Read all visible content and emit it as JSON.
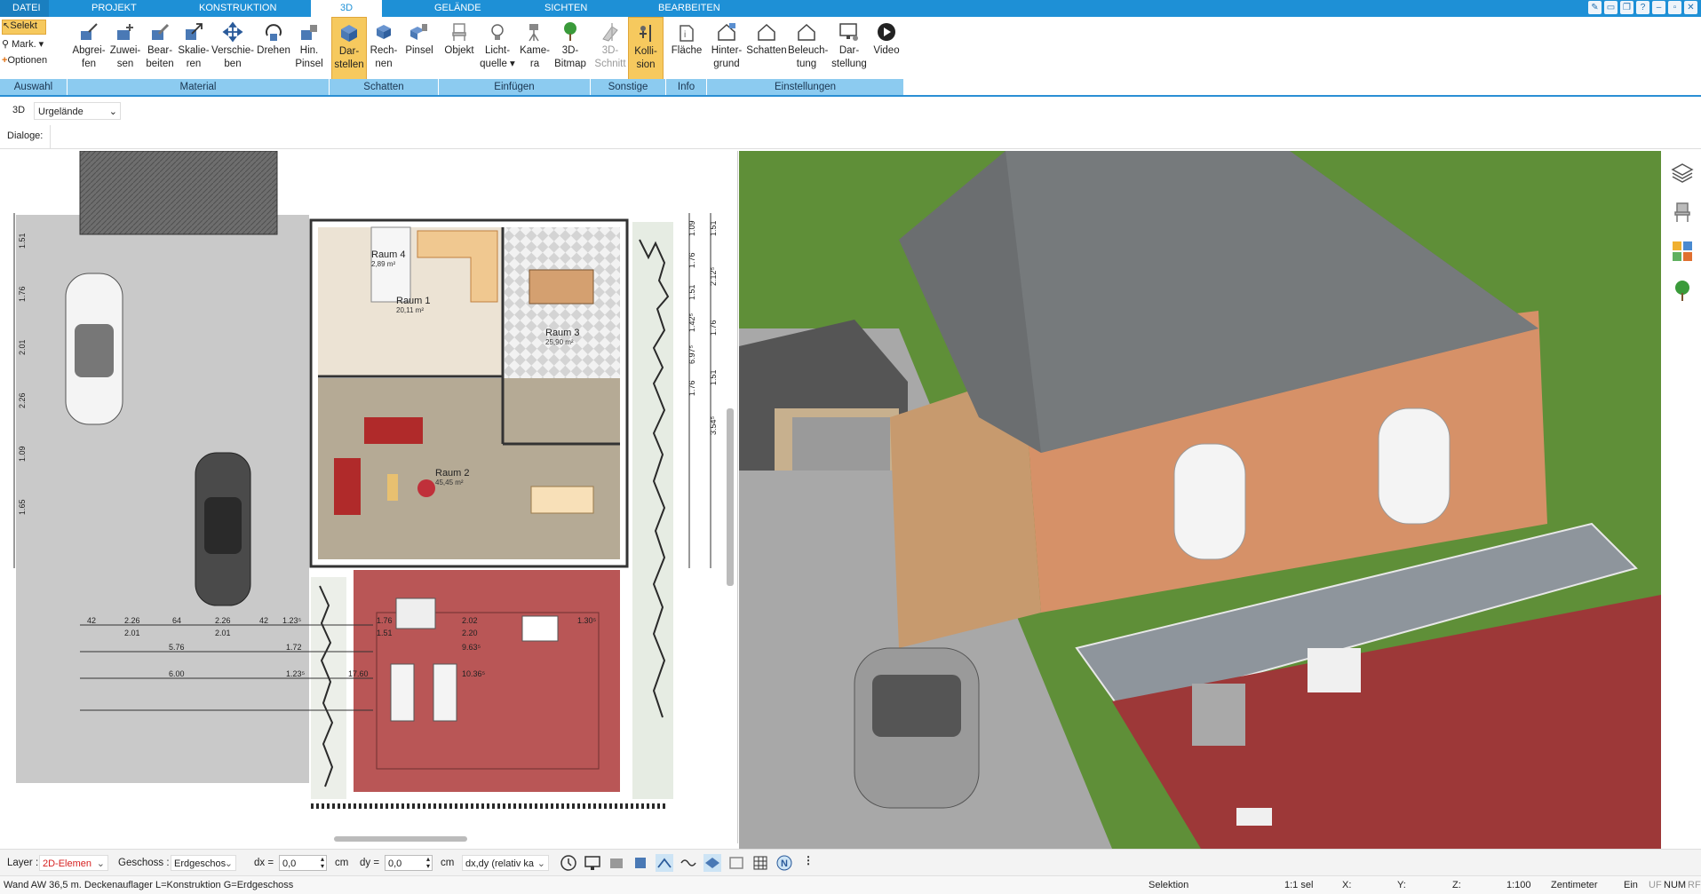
{
  "tabs": {
    "datei": "DATEI",
    "projekt": "PROJEKT",
    "konstruktion": "KONSTRUKTION",
    "d3": "3D",
    "gelaende": "GELÄNDE",
    "sichten": "SICHTEN",
    "bearbeiten": "BEARBEITEN"
  },
  "selection": {
    "selekt": "Selekt",
    "mark": "Mark.",
    "optionen": "Optionen"
  },
  "ribbon": {
    "abgreifen": [
      "Abgrei-",
      "fen"
    ],
    "zuweisen": [
      "Zuwei-",
      "sen"
    ],
    "bearbeiten": [
      "Bear-",
      "beiten"
    ],
    "skalieren": [
      "Skalie-",
      "ren"
    ],
    "verschieben": [
      "Verschie-",
      "ben"
    ],
    "drehen": [
      "Drehen",
      ""
    ],
    "hinpinsel": [
      "Hin.",
      "Pinsel"
    ],
    "darstellen": [
      "Dar-",
      "stellen"
    ],
    "rechnen": [
      "Rech-",
      "nen"
    ],
    "pinsel": [
      "Pinsel",
      ""
    ],
    "objekt": [
      "Objekt",
      ""
    ],
    "lichtquelle": [
      "Licht-",
      "quelle"
    ],
    "kamera": [
      "Kame-",
      "ra"
    ],
    "bitmap": [
      "3D-",
      "Bitmap"
    ],
    "schnitt": [
      "3D-",
      "Schnitt"
    ],
    "kollision": [
      "Kolli-",
      "sion"
    ],
    "flaeche": [
      "Fläche",
      ""
    ],
    "hintergrund": [
      "Hinter-",
      "grund"
    ],
    "schatten": [
      "Schatten",
      ""
    ],
    "beleuchtung": [
      "Beleuch-",
      "tung"
    ],
    "darstellung": [
      "Dar-",
      "stellung"
    ],
    "video": [
      "Video",
      ""
    ]
  },
  "groups": {
    "auswahl": "Auswahl",
    "material": "Material",
    "schatten": "Schatten",
    "einfuegen": "Einfügen",
    "sonstige": "Sonstige",
    "info": "Info",
    "einstellungen": "Einstellungen"
  },
  "viewbar": {
    "mode": "3D",
    "terrain": "Urgelände"
  },
  "dialogbar": {
    "label": "Dialoge:"
  },
  "plan": {
    "rooms": [
      {
        "name": "Raum 4",
        "area": "2,89 m²"
      },
      {
        "name": "Raum 1",
        "area": "20,11 m²"
      },
      {
        "name": "Raum 3",
        "area": "25,90 m²"
      },
      {
        "name": "Raum 2",
        "area": "45,45 m²"
      }
    ],
    "dims_top": [
      "42",
      "2.26",
      "64",
      "2.26",
      "42",
      "1.23⁵",
      "1.76",
      "2.02",
      "1.30⁵"
    ],
    "dims_top2": [
      "2.01",
      "2.01",
      "1.51",
      "2.20"
    ],
    "dims_mid": [
      "5.76",
      "1.72",
      "9.63⁵"
    ],
    "dims_low": [
      "6.00",
      "1.23⁵",
      "10.36⁵",
      "17.60"
    ],
    "dims_right": [
      "1.09",
      "1.76",
      "1.51",
      "1.42⁵",
      "6.97⁵",
      "1.76",
      "1.51",
      "2.12⁵",
      "1.76",
      "1.51",
      "3.54⁵"
    ],
    "dims_left": [
      "1.51",
      "1.76",
      "2.01",
      "2.26",
      "1.09",
      "1.65"
    ]
  },
  "bottombar": {
    "layer_label": "Layer :",
    "layer_value": "2D-Elemen",
    "geschoss_label": "Geschoss :",
    "geschoss_value": "Erdgeschos",
    "dx_label": "dx =",
    "dx_value": "0,0",
    "dx_unit": "cm",
    "dy_label": "dy =",
    "dy_value": "0,0",
    "dy_unit": "cm",
    "mode_value": "dx,dy (relativ ka"
  },
  "statusbar": {
    "message": "Wand AW 36,5 m. Deckenauflager L=Konstruktion G=Erdgeschoss",
    "selection": "Selektion",
    "count": "1:1 sel",
    "x": "X:",
    "y": "Y:",
    "z": "Z:",
    "scale": "1:100",
    "unit": "Zentimeter",
    "ein": "Ein",
    "uf": "UF",
    "num": "NUM",
    "rf": "RF"
  },
  "colors": {
    "accent": "#1e90d6",
    "ribbon_group": "#8ccbf0",
    "active_button": "#f6c95e",
    "layer_text": "#d62020"
  }
}
